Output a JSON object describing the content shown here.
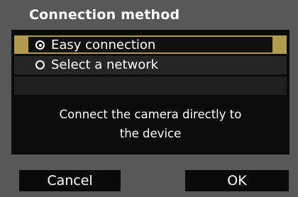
{
  "dialog": {
    "title": "Connection method",
    "options": [
      {
        "label": "Easy connection",
        "selected": true
      },
      {
        "label": "Select a network",
        "selected": false
      }
    ],
    "description_line1": "Connect the camera directly to",
    "description_line2": "the device",
    "cancel_label": "Cancel",
    "ok_label": "OK"
  },
  "colors": {
    "background": "#585858",
    "panel": "#0b0b0b",
    "selection_accent": "#b19b4e",
    "text": "#ffffff"
  },
  "icons": {
    "selected_option": "radio-selected-icon",
    "unselected_option": "radio-unselected-icon"
  }
}
